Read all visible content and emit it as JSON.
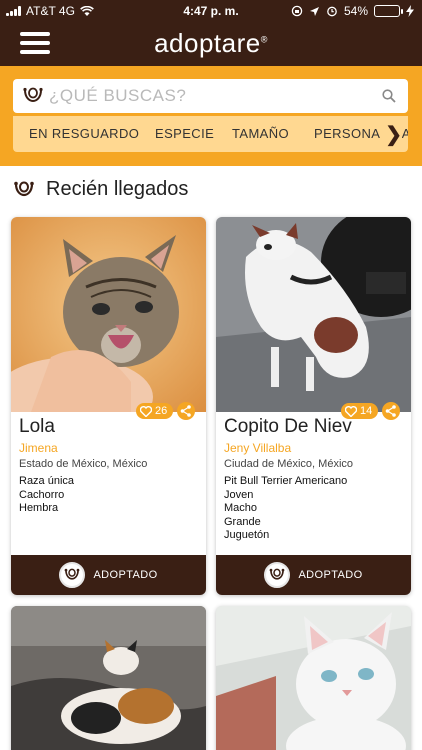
{
  "status_bar": {
    "carrier": "AT&T 4G",
    "time": "4:47 p. m.",
    "battery": "54%",
    "battery_level": 0.54
  },
  "header": {
    "logo": "adoptare",
    "logo_mark": "®"
  },
  "search": {
    "placeholder": "¿QUÉ BUSCAS?"
  },
  "filters": [
    "EN RESGUARDO",
    "ESPECIE",
    "TAMAÑO",
    "PERSONALIDAD"
  ],
  "section": {
    "title": "Recién llegados"
  },
  "pets": [
    {
      "name": "Lola",
      "owner": "Jimena",
      "location": "Estado de México, México",
      "likes": "26",
      "attributes": [
        "Raza única",
        "Cachorro",
        "Hembra"
      ],
      "status": "ADOPTADO"
    },
    {
      "name": "Copito De Niev",
      "owner": "Jeny Villalba",
      "location": "Ciudad de México, México",
      "likes": "14",
      "attributes": [
        "Pit Bull Terrier Americano",
        "Joven",
        "Macho",
        "Grande",
        "Juguetón"
      ],
      "status": "ADOPTADO"
    }
  ],
  "colors": {
    "brand_brown": "#3a1f14",
    "brand_orange": "#f5a623",
    "filter_bg": "#ffd891"
  }
}
